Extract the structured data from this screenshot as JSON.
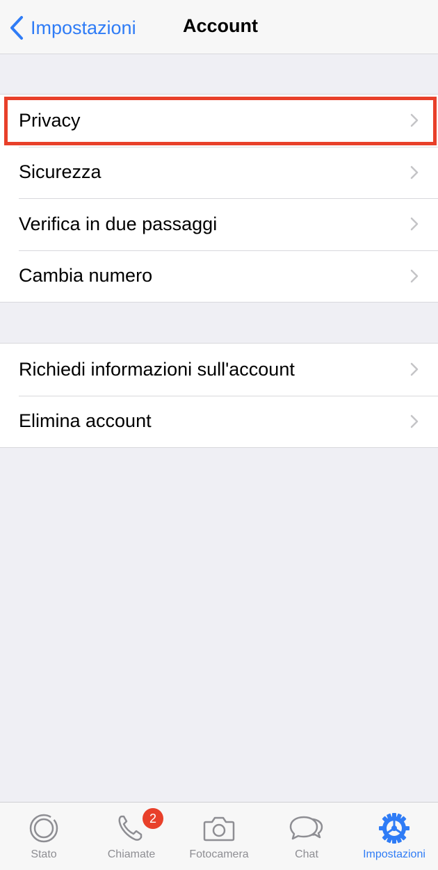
{
  "nav": {
    "back_label": "Impostazioni",
    "title": "Account"
  },
  "group1": {
    "items": [
      {
        "label": "Privacy"
      },
      {
        "label": "Sicurezza"
      },
      {
        "label": "Verifica in due passaggi"
      },
      {
        "label": "Cambia numero"
      }
    ]
  },
  "group2": {
    "items": [
      {
        "label": "Richiedi informazioni sull'account"
      },
      {
        "label": "Elimina account"
      }
    ]
  },
  "tabbar": {
    "tabs": [
      {
        "label": "Stato",
        "icon": "status-icon"
      },
      {
        "label": "Chiamate",
        "icon": "phone-icon",
        "badge": "2"
      },
      {
        "label": "Fotocamera",
        "icon": "camera-icon"
      },
      {
        "label": "Chat",
        "icon": "chat-icon"
      },
      {
        "label": "Impostazioni",
        "icon": "gear-icon",
        "active": true
      }
    ]
  },
  "colors": {
    "accent": "#2f7cf6",
    "highlight": "#e8402a",
    "background": "#efeff4"
  }
}
